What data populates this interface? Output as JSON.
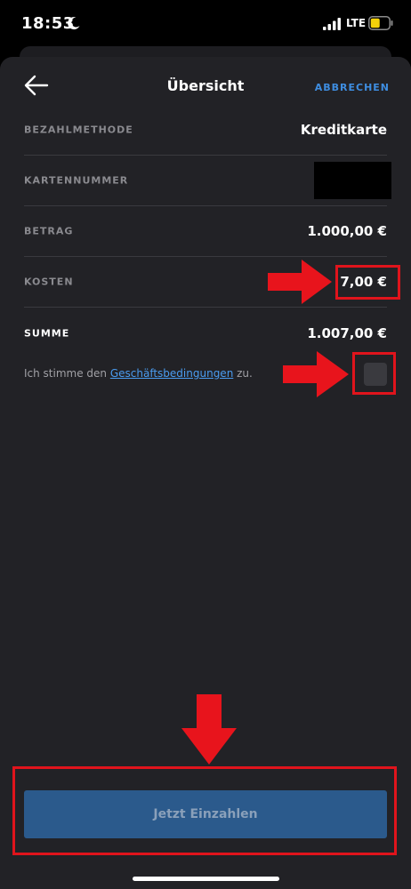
{
  "status_bar": {
    "time": "18:53",
    "network": "LTE",
    "icons": [
      "moon-icon",
      "signal-icon",
      "battery-icon"
    ]
  },
  "header": {
    "title": "Übersicht",
    "cancel_label": "ABBRECHEN",
    "back_icon": "arrow-left-icon"
  },
  "summary": {
    "rows": [
      {
        "label": "BEZAHLMETHODE",
        "value": "Kreditkarte"
      },
      {
        "label": "KARTENNUMMER",
        "value": ""
      },
      {
        "label": "BETRAG",
        "value": "1.000,00 €"
      },
      {
        "label": "KOSTEN",
        "value": "7,00 €"
      },
      {
        "label": "SUMME",
        "value": "1.007,00 €"
      }
    ]
  },
  "terms": {
    "prefix": "Ich stimme den ",
    "link": "Geschäftsbedingungen",
    "suffix": " zu.",
    "checked": false
  },
  "action": {
    "deposit_label": "Jetzt Einzahlen"
  },
  "colors": {
    "background": "#222226",
    "accent": "#3e8de0",
    "button": "#2b5a8c",
    "annotation": "#e0141c",
    "battery": "#f5d20a"
  }
}
